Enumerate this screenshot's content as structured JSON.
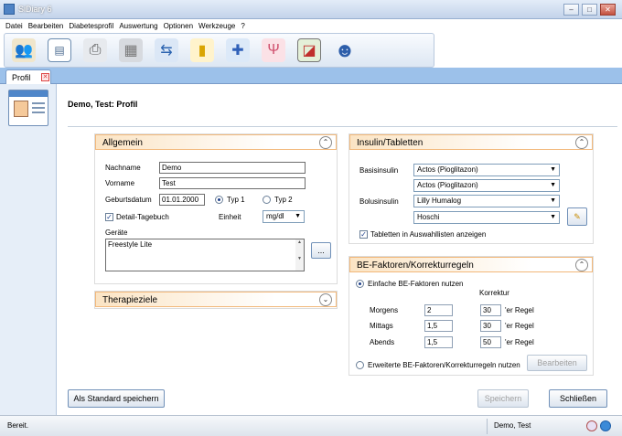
{
  "window": {
    "title": "SiDiary 6"
  },
  "menu": [
    "Datei",
    "Bearbeiten",
    "Diabetesprofil",
    "Auswertung",
    "Optionen",
    "Werkzeuge",
    "?"
  ],
  "toolbar_icons": [
    "users-icon",
    "profile-card-icon",
    "printer-icon",
    "calculator-icon",
    "network-icon",
    "bars-icon",
    "grid-icon",
    "utensils-icon",
    "chart-icon",
    "smiley-icon"
  ],
  "tab": {
    "label": "Profil"
  },
  "page": {
    "title": "Demo, Test: Profil"
  },
  "allgemein": {
    "header": "Allgemein",
    "nachname_label": "Nachname",
    "nachname_value": "Demo",
    "vorname_label": "Vorname",
    "vorname_value": "Test",
    "geburtsdatum_label": "Geburtsdatum",
    "geburtsdatum_value": "01.01.2000",
    "typ1_label": "Typ 1",
    "typ2_label": "Typ 2",
    "detail_label": "Detail-Tagebuch",
    "einheit_label": "Einheit",
    "einheit_value": "mg/dl",
    "geraete_label": "Geräte",
    "geraete_value": "Freestyle Lite",
    "more_label": "..."
  },
  "therapieziele": {
    "header": "Therapieziele"
  },
  "insulin": {
    "header": "Insulin/Tabletten",
    "basis_label": "Basisinsulin",
    "basis_1": "Actos (Pioglitazon)",
    "basis_2": "Actos (Pioglitazon)",
    "bolus_label": "Bolusinsulin",
    "bolus_1": "Lilly Humalog",
    "bolus_2": "Hoschi",
    "tabletten_label": "Tabletten in Auswahllisten anzeigen"
  },
  "be": {
    "header": "BE-Faktoren/Korrekturregeln",
    "einfach_label": "Einfache BE-Faktoren nutzen",
    "korrektur_label": "Korrektur",
    "rows": [
      {
        "label": "Morgens",
        "factor": "2",
        "korrektur": "30",
        "suffix": "'er Regel"
      },
      {
        "label": "Mittags",
        "factor": "1,5",
        "korrektur": "30",
        "suffix": "'er Regel"
      },
      {
        "label": "Abends",
        "factor": "1,5",
        "korrektur": "50",
        "suffix": "'er Regel"
      }
    ],
    "erweitert_label": "Erweiterte BE-Faktoren/Korrekturregeln nutzen",
    "bearbeiten_label": "Bearbeiten"
  },
  "buttons": {
    "standard": "Als Standard speichern",
    "speichern": "Speichern",
    "schliessen": "Schließen"
  },
  "status": {
    "left": "Bereit.",
    "user": "Demo, Test"
  }
}
